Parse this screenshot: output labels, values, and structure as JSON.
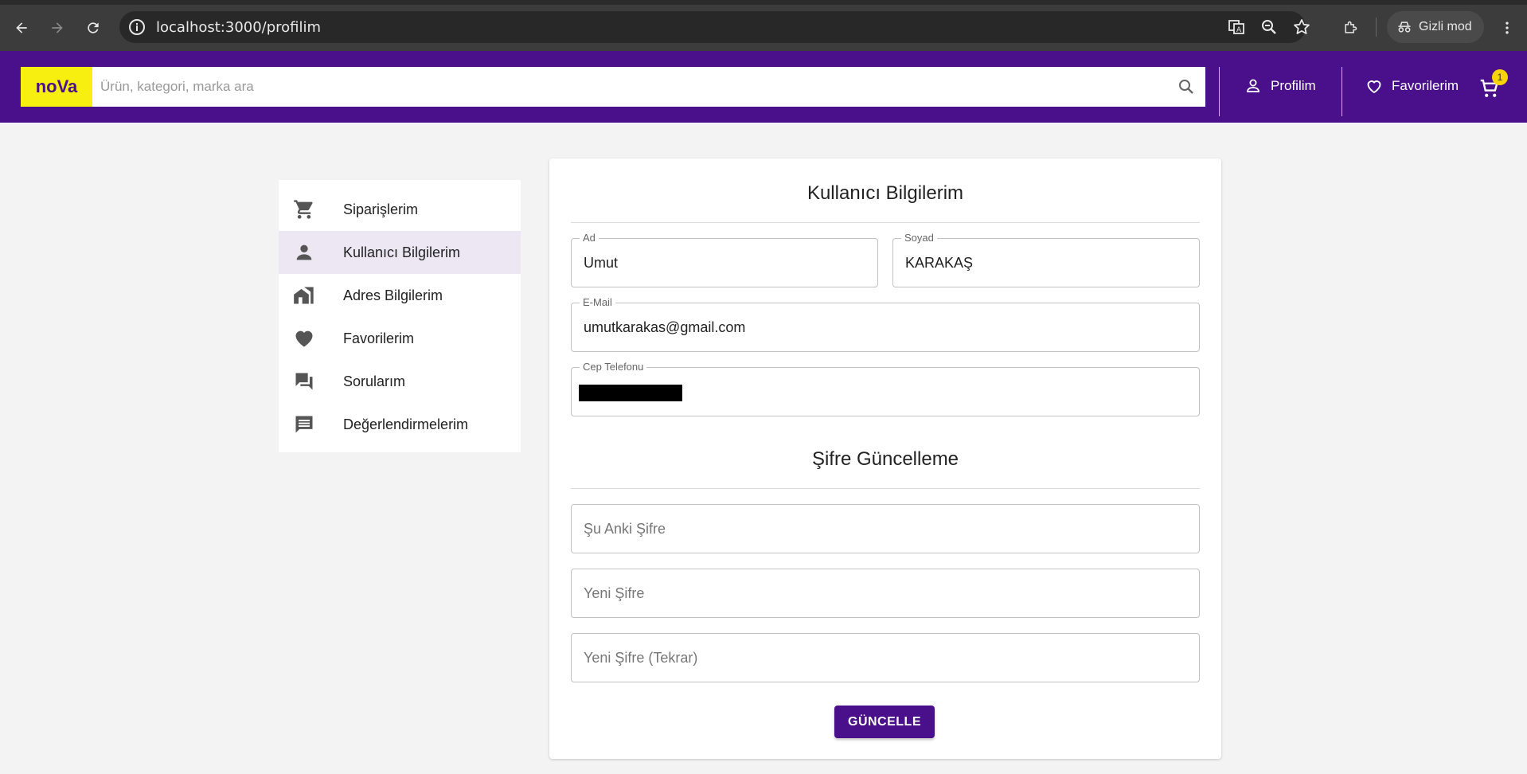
{
  "browser": {
    "url": "localhost:3000/profilim",
    "incognito_label": "Gizli mod"
  },
  "header": {
    "logo": "noVa",
    "search_placeholder": "Ürün, kategori, marka ara",
    "profile_label": "Profilim",
    "favorites_label": "Favorilerim",
    "cart_count": "1",
    "brand_color": "#4a0f8a",
    "logo_color": "#f7ef10"
  },
  "sidebar": {
    "items": [
      {
        "label": "Siparişlerim",
        "icon": "cart-icon"
      },
      {
        "label": "Kullanıcı Bilgilerim",
        "icon": "person-icon",
        "active": true
      },
      {
        "label": "Adres Bilgilerim",
        "icon": "address-icon"
      },
      {
        "label": "Favorilerim",
        "icon": "heart-icon"
      },
      {
        "label": "Sorularım",
        "icon": "forum-icon"
      },
      {
        "label": "Değerlendirmelerim",
        "icon": "comment-icon"
      }
    ]
  },
  "user_info": {
    "title": "Kullanıcı Bilgilerim",
    "first_name_label": "Ad",
    "first_name": "Umut",
    "last_name_label": "Soyad",
    "last_name": "KARAKAŞ",
    "email_label": "E-Mail",
    "email": "umutkarakas@gmail.com",
    "phone_label": "Cep Telefonu"
  },
  "password": {
    "title": "Şifre Güncelleme",
    "current_placeholder": "Şu Anki Şifre",
    "new_placeholder": "Yeni Şifre",
    "repeat_placeholder": "Yeni Şifre (Tekrar)",
    "submit_label": "GÜNCELLE"
  }
}
